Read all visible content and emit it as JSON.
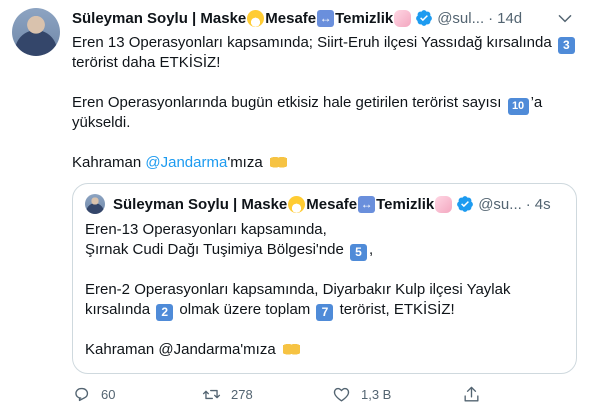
{
  "tweet": {
    "author_name": "Süleyman Soylu | Maske",
    "author_name_mid": "Mesafe",
    "author_name_end": "Temizlik",
    "handle": "@sul...",
    "separator": "·",
    "time": "14d",
    "line1_pre": "Eren 13 Operasyonları kapsamında; Siirt-Eruh ilçesi Yassıdağ kırsalında",
    "line1_num": "3",
    "line2": "terörist daha ETKİSİZ!",
    "line3_pre": "Eren Operasyonlarında  bugün etkisiz hale getirilen terörist sayısı",
    "line3_num": "10",
    "line3_post": "’a",
    "line4": "yükseldi.",
    "line5_pre": "Kahraman",
    "line5_mention": "@Jandarma",
    "line5_post": "'mıza"
  },
  "quoted": {
    "author_name": "Süleyman Soylu | Maske",
    "author_name_mid": "Mesafe",
    "author_name_end": "Temizlik",
    "handle": "@su...",
    "separator": "·",
    "time": "4s",
    "line1": "Eren-13 Operasyonları kapsamında,",
    "line2_pre": "Şırnak Cudi Dağı Tuşimiya Bölgesi'nde",
    "line2_num": "5",
    "line2_post": ",",
    "line3": "Eren-2 Operasyonları kapsamında, Diyarbakır Kulp ilçesi Yaylak",
    "line4_pre": "kırsalında",
    "line4_num1": "2",
    "line4_mid": "olmak üzere toplam",
    "line4_num2": "7",
    "line4_post": "terörist, ETKİSİZ!",
    "line5": "Kahraman @Jandarma'mıza"
  },
  "actions": {
    "reply_count": "60",
    "retweet_count": "278",
    "like_count": "1,3 B"
  },
  "colors": {
    "text": "#0f1419",
    "secondary": "#536471",
    "link": "#1d9bf0",
    "border": "#cfd9de",
    "keycap": "#4f8bd8"
  },
  "icons": [
    "mask-emoji",
    "left-right-arrow-emoji",
    "soap-emoji",
    "verified-badge-icon",
    "chevron-down-icon",
    "keycap-number",
    "clapping-hands-emoji",
    "reply-icon",
    "retweet-icon",
    "like-icon",
    "share-icon"
  ]
}
